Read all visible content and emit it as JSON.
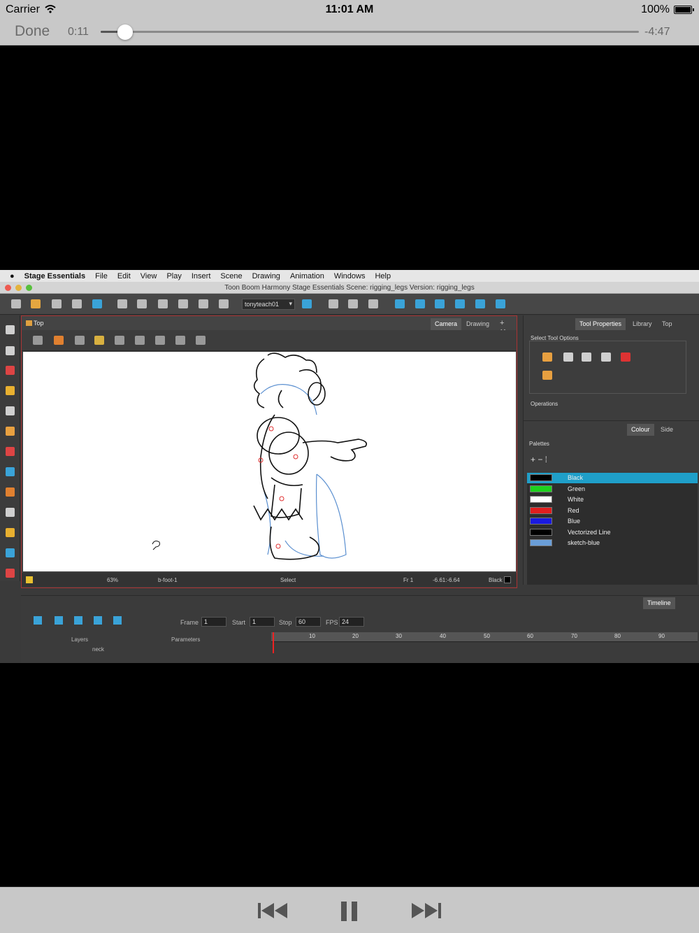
{
  "ios": {
    "carrier": "Carrier",
    "time": "11:01 AM",
    "battery": "100%"
  },
  "player": {
    "done_label": "Done",
    "elapsed": "0:11",
    "remaining": "-4:47",
    "progress": 0.037
  },
  "mac_menu": {
    "app": "Stage Essentials",
    "items": [
      "File",
      "Edit",
      "View",
      "Play",
      "Insert",
      "Scene",
      "Drawing",
      "Animation",
      "Windows",
      "Help"
    ]
  },
  "window_title": "Toon Boom Harmony Stage Essentials Scene: rigging_legs Version: rigging_legs",
  "toolbar": {
    "user_dropdown": "tonyteach01"
  },
  "stage_view": {
    "breadcrumb": "Top",
    "tabs": [
      "Camera",
      "Drawing"
    ],
    "status": {
      "zoom": "63%",
      "node": "b-foot-1",
      "tool": "Select",
      "frame": "Fr 1",
      "coords": "-6.61:-6.64",
      "colour": "Black"
    }
  },
  "tool_properties": {
    "tabs": [
      "Tool Properties",
      "Library",
      "Top"
    ],
    "select_label": "Select Tool Options",
    "operations_label": "Operations"
  },
  "colour_panel": {
    "tabs": [
      "Colour",
      "Side"
    ],
    "palettes_label": "Palettes",
    "swatches": [
      {
        "name": "Black",
        "color": "#000000"
      },
      {
        "name": "Green",
        "color": "#1ed21e"
      },
      {
        "name": "White",
        "color": "#ffffff"
      },
      {
        "name": "Red",
        "color": "#e01e1e"
      },
      {
        "name": "Blue",
        "color": "#1a1ae0"
      },
      {
        "name": "Vectorized Line",
        "color": "#000000"
      },
      {
        "name": "sketch-blue",
        "color": "#6a9ed8"
      }
    ]
  },
  "timeline": {
    "tab": "Timeline",
    "frame_label": "Frame",
    "frame_value": "1",
    "start_label": "Start",
    "start_value": "1",
    "stop_label": "Stop",
    "stop_value": "60",
    "fps_label": "FPS",
    "fps_value": "24",
    "layers_label": "Layers",
    "parameters_label": "Parameters",
    "layer_row": "neck",
    "ruler_ticks": [
      "10",
      "20",
      "30",
      "40",
      "50",
      "60",
      "70",
      "80",
      "90"
    ]
  }
}
